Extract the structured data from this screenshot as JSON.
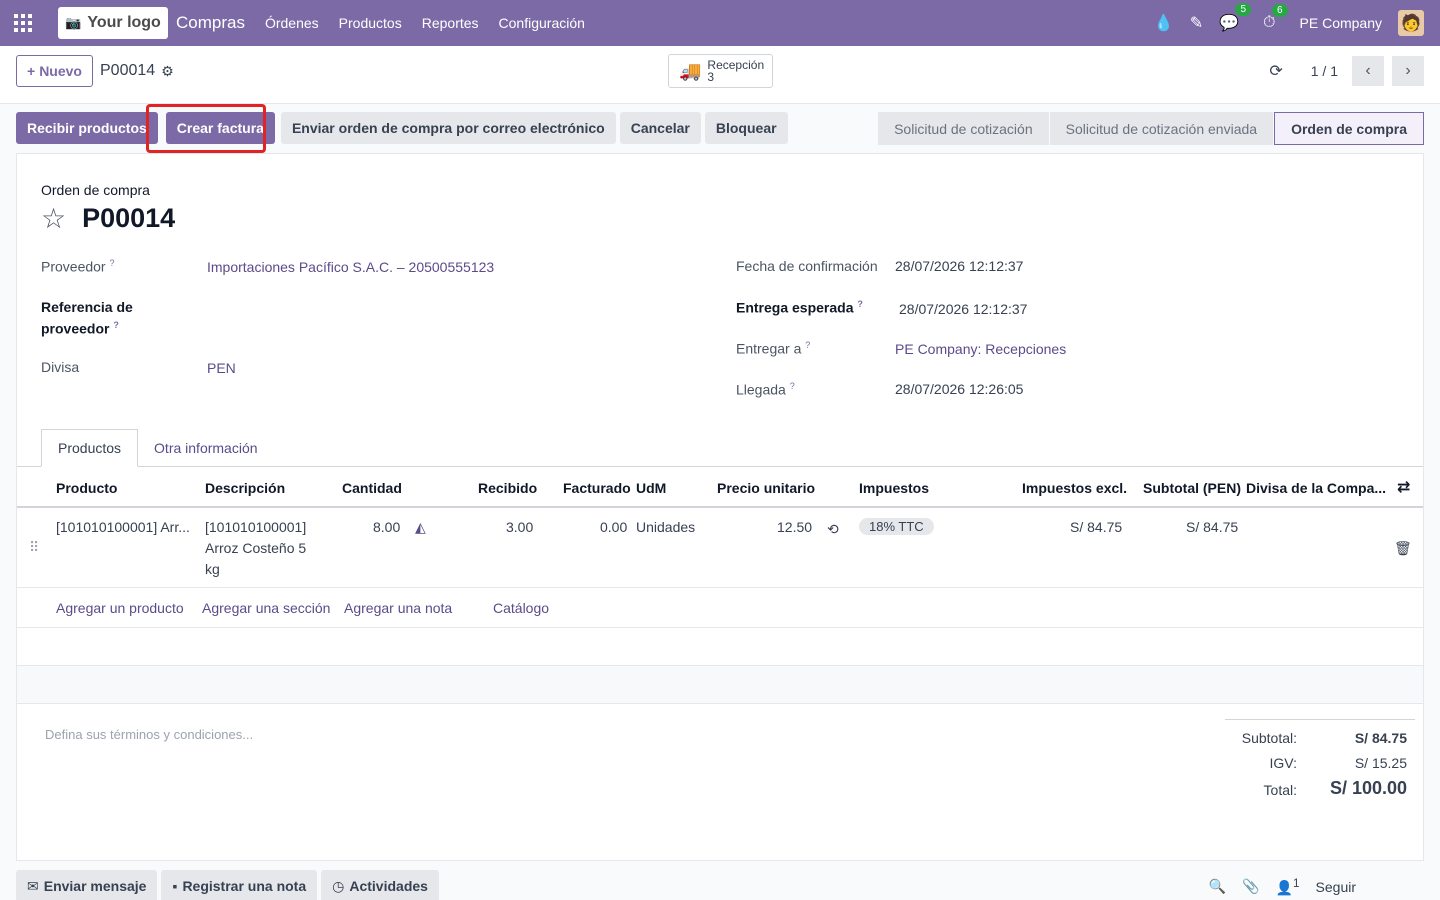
{
  "navbar": {
    "logo_text": "Your logo",
    "app_name": "Compras",
    "menu": [
      "Órdenes",
      "Productos",
      "Reportes",
      "Configuración"
    ],
    "messages_badge": "5",
    "activities_badge": "6",
    "company": "PE Company"
  },
  "control_panel": {
    "new_label": "Nuevo",
    "record_name": "P00014",
    "smart_button": {
      "label": "Recepción",
      "count": "3"
    },
    "pager": "1 / 1"
  },
  "actions": {
    "receive": "Recibir productos",
    "create_invoice": "Crear factura",
    "send_email": "Enviar orden de compra por correo electrónico",
    "cancel": "Cancelar",
    "lock": "Bloquear"
  },
  "status_bar": [
    "Solicitud de cotización",
    "Solicitud de cotización enviada",
    "Orden de compra"
  ],
  "form": {
    "doc_type": "Orden de compra",
    "doc_name": "P00014",
    "left_fields": {
      "vendor_label": "Proveedor",
      "vendor_value": "Importaciones Pacífico S.A.C. – 20500555123",
      "vendor_ref_label_1": "Referencia de",
      "vendor_ref_label_2": "proveedor",
      "currency_label": "Divisa",
      "currency_value": "PEN"
    },
    "right_fields": {
      "confirm_label": "Fecha de confirmación",
      "confirm_value": "28/07/2026 12:12:37",
      "expected_label": "Entrega esperada",
      "expected_value": "28/07/2026 12:12:37",
      "deliver_label": "Entregar a",
      "deliver_value": "PE Company: Recepciones",
      "arrival_label": "Llegada",
      "arrival_value": "28/07/2026 12:26:05"
    }
  },
  "tabs": [
    "Productos",
    "Otra información"
  ],
  "table": {
    "headers": [
      "Producto",
      "Descripción",
      "Cantidad",
      "Recibido",
      "Facturado",
      "UdM",
      "Precio unitario",
      "Impuestos",
      "Impuestos excl.",
      "Subtotal (PEN)",
      "Divisa de la Compa..."
    ],
    "row": {
      "product": "[101010100001] Arr...",
      "desc_1": "[101010100001]",
      "desc_2": "Arroz Costeño 5",
      "desc_3": "kg",
      "qty": "8.00",
      "received": "3.00",
      "invoiced": "0.00",
      "uom": "Unidades",
      "price": "12.50",
      "tax": "18% TTC",
      "tax_excl": "S/ 84.75",
      "subtotal": "S/ 84.75"
    },
    "add_links": [
      "Agregar un producto",
      "Agregar una sección",
      "Agregar una nota",
      "Catálogo"
    ]
  },
  "terms_placeholder": "Defina sus términos y condiciones...",
  "totals": {
    "subtotal_label": "Subtotal:",
    "subtotal_value": "S/ 84.75",
    "igv_label": "IGV:",
    "igv_value": "S/ 15.25",
    "total_label": "Total:",
    "total_value": "S/ 100.00"
  },
  "chatter": {
    "send_message": "Enviar mensaje",
    "log_note": "Registrar una nota",
    "activities": "Actividades",
    "followers_count": "1",
    "follow": "Seguir"
  }
}
